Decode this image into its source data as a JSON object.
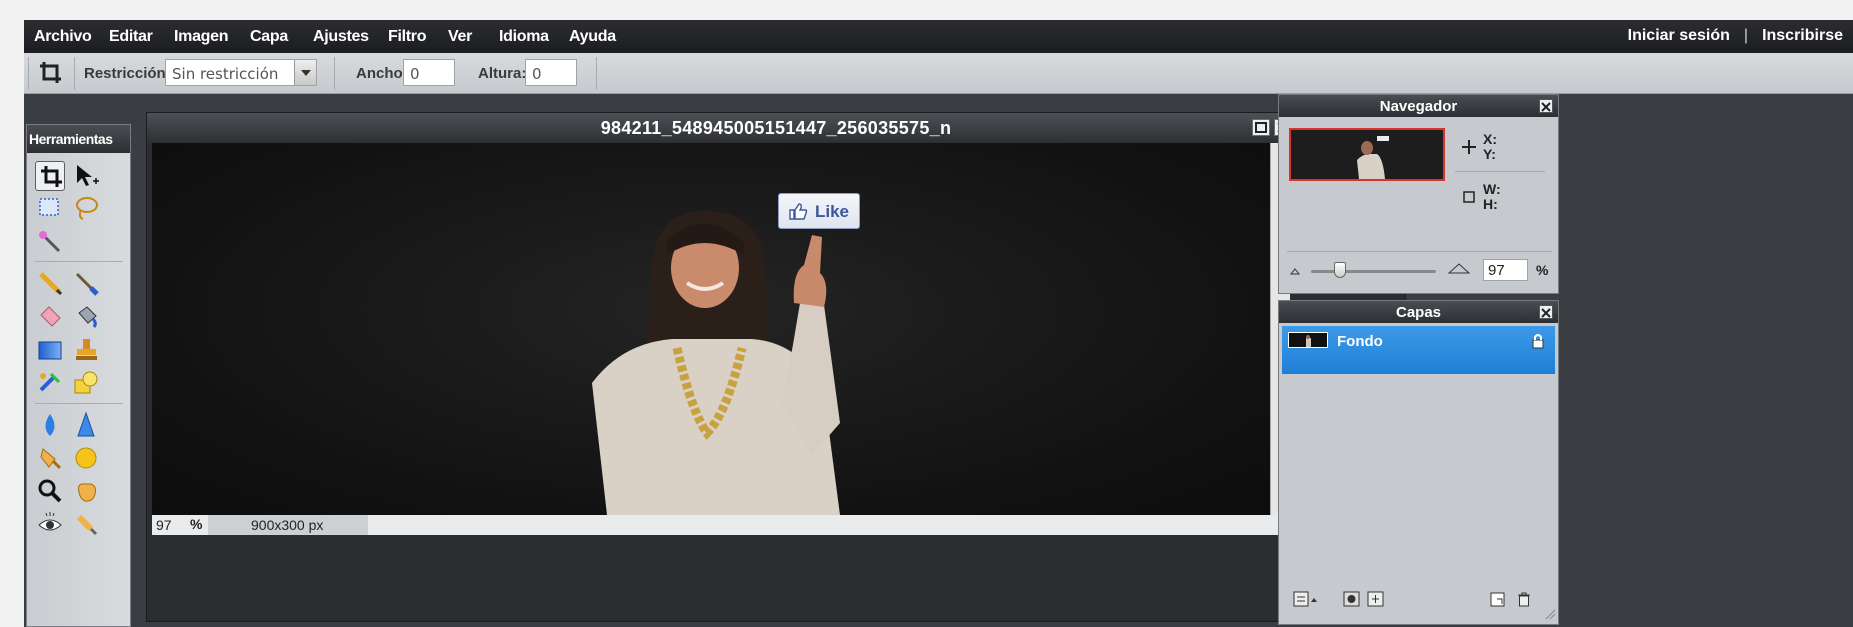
{
  "menu": {
    "items": [
      "Archivo",
      "Editar",
      "Imagen",
      "Capa",
      "Ajustes",
      "Filtro",
      "Ver",
      "Idioma",
      "Ayuda"
    ],
    "login": "Iniciar sesión",
    "separator": "|",
    "signup": "Inscribirse"
  },
  "options": {
    "restriction_label": "Restricción:",
    "restriction_value": "Sin restricción",
    "width_label": "Ancho:",
    "width_value": "0",
    "height_label": "Altura:",
    "height_value": "0"
  },
  "tools": {
    "title": "Herramientas",
    "icons": [
      "crop-icon",
      "move-icon",
      "marquee-icon",
      "lasso-icon",
      "magic-wand-icon",
      "pencil-icon",
      "brush-icon",
      "eraser-icon",
      "paint-bucket-icon",
      "gradient-icon",
      "clone-stamp-icon",
      "color-replace-icon",
      "shape-icon",
      "blur-icon",
      "sharpen-icon",
      "smudge-icon",
      "sponge-icon",
      "zoom-icon",
      "hand-icon",
      "red-eye-icon",
      "color-picker-icon"
    ],
    "active": "crop-icon"
  },
  "document": {
    "title": "984211_548945005151447_256035575_n",
    "zoom": "97",
    "zoom_unit": "%",
    "size": "900x300 px",
    "like_text": "Like"
  },
  "navigator": {
    "title": "Navegador",
    "x_label": "X:",
    "y_label": "Y:",
    "w_label": "W:",
    "h_label": "H:",
    "zoom": "97",
    "zoom_unit": "%",
    "zoom_slider_level": 0.2
  },
  "layers": {
    "title": "Capas",
    "items": [
      {
        "name": "Fondo",
        "locked": true,
        "selected": true
      }
    ]
  },
  "colors": {
    "menubar": "#1c1d20",
    "selection_blue": "#1f7fd6",
    "nav_frame": "#d9332a",
    "like_blue": "#3b5998"
  }
}
